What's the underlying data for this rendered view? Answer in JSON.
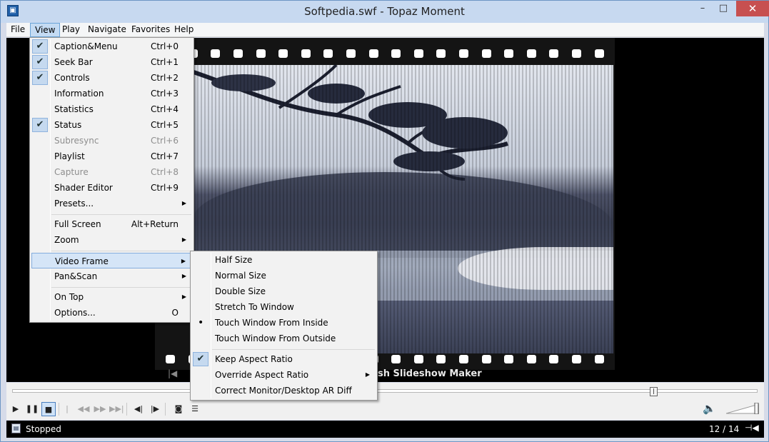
{
  "window": {
    "title": "Softpedia.swf - Topaz Moment",
    "min_glyph": "–",
    "max_glyph": "□",
    "close_glyph": "✕"
  },
  "menubar": [
    "File",
    "View",
    "Play",
    "Navigate",
    "Favorites",
    "Help"
  ],
  "view_menu": {
    "items": [
      {
        "label": "Caption&Menu",
        "shortcut": "Ctrl+0",
        "checked": true
      },
      {
        "label": "Seek Bar",
        "shortcut": "Ctrl+1",
        "checked": true
      },
      {
        "label": "Controls",
        "shortcut": "Ctrl+2",
        "checked": true
      },
      {
        "label": "Information",
        "shortcut": "Ctrl+3"
      },
      {
        "label": "Statistics",
        "shortcut": "Ctrl+4"
      },
      {
        "label": "Status",
        "shortcut": "Ctrl+5",
        "checked": true
      },
      {
        "label": "Subresync",
        "shortcut": "Ctrl+6",
        "disabled": true
      },
      {
        "label": "Playlist",
        "shortcut": "Ctrl+7"
      },
      {
        "label": "Capture",
        "shortcut": "Ctrl+8",
        "disabled": true
      },
      {
        "label": "Shader Editor",
        "shortcut": "Ctrl+9"
      },
      {
        "label": "Presets...",
        "submenu": true
      },
      {
        "label": "Full Screen",
        "shortcut": "Alt+Return"
      },
      {
        "label": "Zoom",
        "submenu": true
      },
      {
        "label": "Video Frame",
        "submenu": true,
        "highlighted": true
      },
      {
        "label": "Pan&Scan",
        "submenu": true
      },
      {
        "label": "On Top",
        "submenu": true
      },
      {
        "label": "Options...",
        "shortcut": "O"
      }
    ]
  },
  "video_frame_menu": {
    "items": [
      {
        "label": "Half Size"
      },
      {
        "label": "Normal Size"
      },
      {
        "label": "Double Size"
      },
      {
        "label": "Stretch To Window"
      },
      {
        "label": "Touch Window From Inside",
        "radio": true
      },
      {
        "label": "Touch Window From Outside"
      },
      {
        "label": "Keep Aspect Ratio",
        "checked": true
      },
      {
        "label": "Override Aspect Ratio",
        "submenu": true
      },
      {
        "label": "Correct Monitor/Desktop AR Diff"
      }
    ]
  },
  "video": {
    "caption": "sh Slideshow Maker",
    "caption_prev": "|◀"
  },
  "controls": {
    "seek_position": 0.86
  },
  "status": {
    "text": "Stopped",
    "position": "12 / 14"
  },
  "icons": {
    "check": "✔",
    "arrow": "▶",
    "dot": "•",
    "volume": "🔈"
  }
}
